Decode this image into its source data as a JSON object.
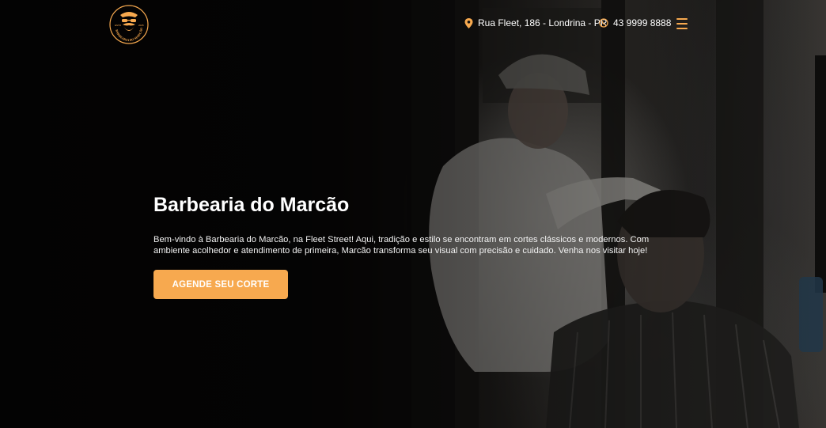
{
  "brand": {
    "name": "Barbearia do Marcão",
    "logo_text": "BARBEARIA DO MARCÃO",
    "logo_left": "ESTD",
    "logo_right": "2025",
    "accent_color": "#f7a94f"
  },
  "header": {
    "address": "Rua Fleet, 186 - Londrina - PR",
    "address_icon": "map-pin-icon",
    "phone": "43 9999 8888",
    "phone_icon": "whatsapp-icon",
    "menu_icon": "hamburger-menu-icon"
  },
  "hero": {
    "title": "Barbearia do Marcão",
    "description": "Bem-vindo à Barbearia do Marcão, na Fleet Street! Aqui, tradição e estilo se encontram em cortes clássicos e modernos. Com ambiente acolhedor e atendimento de primeira, Marcão transforma seu visual com precisão e cuidado. Venha nos visitar hoje!",
    "cta_label": "AGENDE SEU CORTE"
  }
}
